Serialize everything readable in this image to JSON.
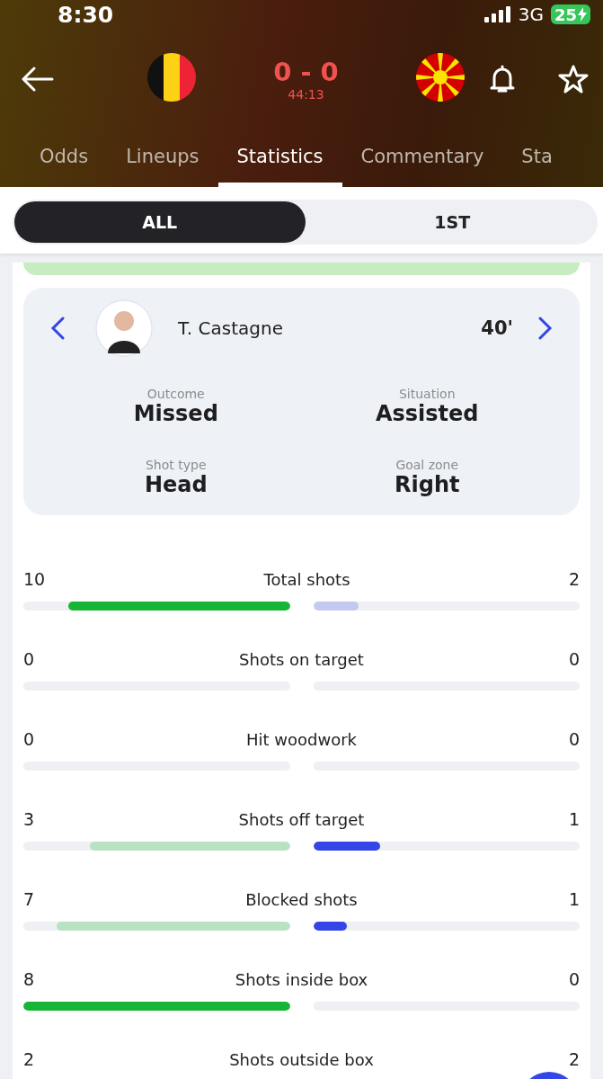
{
  "status_bar": {
    "time": "8:30",
    "network": "3G",
    "battery": "25"
  },
  "match": {
    "score": "0 - 0",
    "clock": "44:13"
  },
  "tabs": [
    {
      "label": "Odds",
      "selected": false
    },
    {
      "label": "Lineups",
      "selected": false
    },
    {
      "label": "Statistics",
      "selected": true
    },
    {
      "label": "Commentary",
      "selected": false
    },
    {
      "label": "Sta",
      "selected": false
    }
  ],
  "periods": [
    {
      "label": "ALL",
      "selected": true
    },
    {
      "label": "1ST",
      "selected": false
    }
  ],
  "shot": {
    "player": "T. Castagne",
    "minute": "40'",
    "details": [
      {
        "label": "Outcome",
        "value": "Missed"
      },
      {
        "label": "Situation",
        "value": "Assisted"
      },
      {
        "label": "Shot type",
        "value": "Head"
      },
      {
        "label": "Goal zone",
        "value": "Right"
      }
    ]
  },
  "stats": [
    {
      "name": "Total shots",
      "home": "10",
      "away": "2",
      "home_bar": {
        "level": 0.83,
        "highlight": true
      },
      "away_bar": {
        "level": 0.17,
        "highlight": false
      }
    },
    {
      "name": "Shots on target",
      "home": "0",
      "away": "0"
    },
    {
      "name": "Hit woodwork",
      "home": "0",
      "away": "0"
    },
    {
      "name": "Shots off target",
      "home": "3",
      "away": "1",
      "home_bar": {
        "level": 0.75,
        "highlight": false
      },
      "away_bar": {
        "level": 0.25,
        "highlight": true
      }
    },
    {
      "name": "Blocked shots",
      "home": "7",
      "away": "1",
      "home_bar": {
        "level": 0.875,
        "highlight": false
      },
      "away_bar": {
        "level": 0.125,
        "highlight": true
      }
    },
    {
      "name": "Shots inside box",
      "home": "8",
      "away": "0",
      "home_bar": {
        "level": 1,
        "highlight": true
      }
    },
    {
      "name": "Shots outside box",
      "home": "2",
      "away": "2"
    }
  ]
}
